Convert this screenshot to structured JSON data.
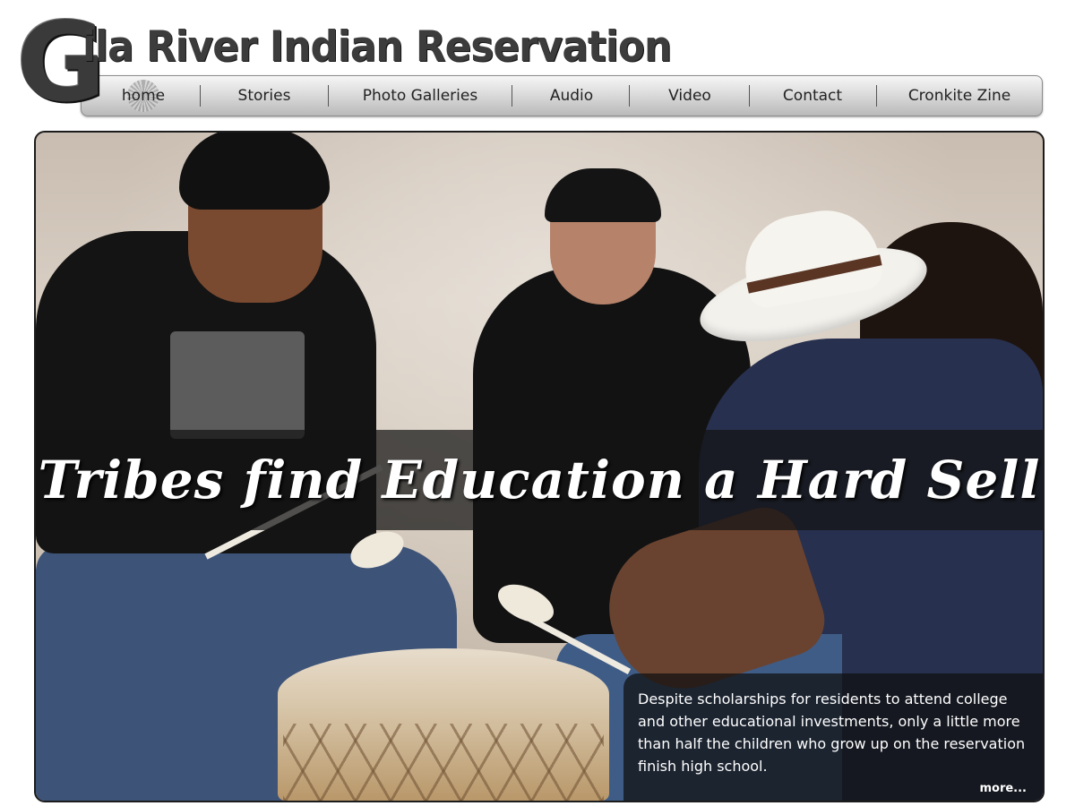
{
  "header": {
    "logo_initial": "G",
    "logo_rest": "ila River Indian Reservation"
  },
  "nav": {
    "items": [
      {
        "label": "home"
      },
      {
        "label": "Stories"
      },
      {
        "label": "Photo Galleries"
      },
      {
        "label": "Audio"
      },
      {
        "label": "Video"
      },
      {
        "label": "Contact"
      },
      {
        "label": "Cronkite Zine"
      }
    ]
  },
  "hero": {
    "headline": "Tribes find Education a Hard Sell",
    "caption": "Despite scholarships for residents to attend college and other educational investments, only a little more than half the children who grow up on the reservation finish high school.",
    "more_label": "more..."
  }
}
